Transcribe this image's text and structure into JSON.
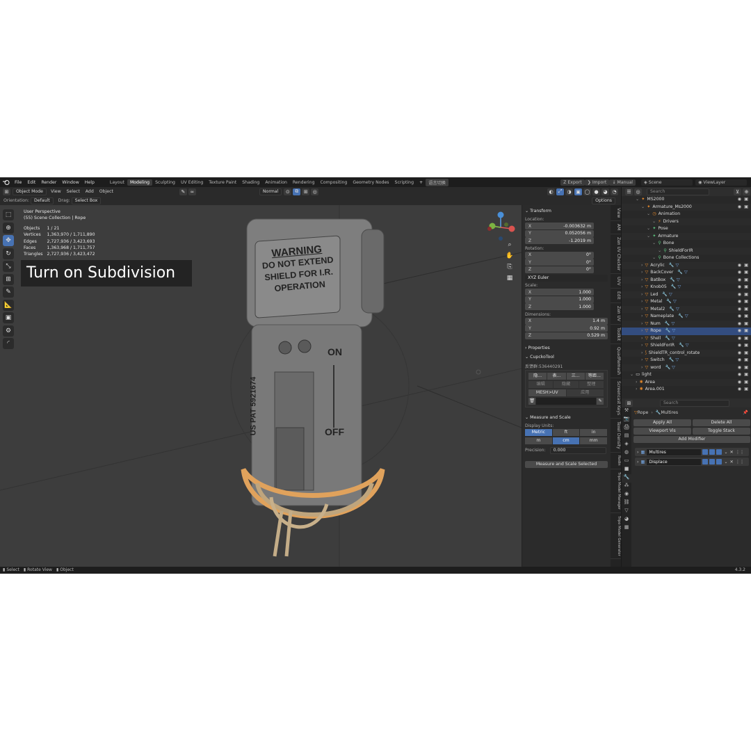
{
  "menubar": {
    "menus": [
      "File",
      "Edit",
      "Render",
      "Window",
      "Help"
    ],
    "workspaces": [
      "Layout",
      "Modeling",
      "Sculpting",
      "UV Editing",
      "Texture Paint",
      "Shading",
      "Animation",
      "Rendering",
      "Compositing",
      "Geometry Nodes",
      "Scripting"
    ],
    "active_workspace": "Modeling",
    "lang_button": "语言切换",
    "export": "Export",
    "import": "Import",
    "manual": "Manual",
    "scene": "Scene",
    "view_layer": "ViewLayer"
  },
  "header": {
    "mode": "Object Mode",
    "menus": [
      "View",
      "Select",
      "Add",
      "Object"
    ],
    "shading_pivot": "Normal",
    "orientation_label": "Orientation:",
    "orientation": "Default",
    "drag_label": "Drag:",
    "drag": "Select Box",
    "options": "Options"
  },
  "viewport": {
    "perspective": "User Perspective",
    "collection": "(55) Scene Collection | Rope",
    "stats": [
      {
        "label": "Objects",
        "value": "1 / 21"
      },
      {
        "label": "Vertices",
        "value": "1,363,970 / 1,711,890"
      },
      {
        "label": "Edges",
        "value": "2,727,936 / 3,423,693"
      },
      {
        "label": "Faces",
        "value": "1,363,968 / 1,711,757"
      },
      {
        "label": "Triangles",
        "value": "2,727,936 / 3,423,472"
      }
    ],
    "caption": "Turn on Subdivision",
    "model_text": {
      "warning": "WARNING",
      "line1": "DO NOT EXTEND",
      "line2": "SHIELD FOR I.R.",
      "line3": "OPERATION",
      "on": "ON",
      "off": "OFF",
      "side": "US PAT 5921674"
    }
  },
  "npanel": {
    "transform_title": "Transform",
    "location_label": "Location:",
    "location": [
      {
        "axis": "X",
        "value": "-0.003632 m"
      },
      {
        "axis": "Y",
        "value": "0.052056 m"
      },
      {
        "axis": "Z",
        "value": "-1.2019 m"
      }
    ],
    "rotation_label": "Rotation:",
    "rotation": [
      {
        "axis": "X",
        "value": "0°"
      },
      {
        "axis": "Y",
        "value": "0°"
      },
      {
        "axis": "Z",
        "value": "0°"
      }
    ],
    "rotation_mode": "XYZ Euler",
    "scale_label": "Scale:",
    "scale": [
      {
        "axis": "X",
        "value": "1.000"
      },
      {
        "axis": "Y",
        "value": "1.000"
      },
      {
        "axis": "Z",
        "value": "1.000"
      }
    ],
    "dimensions_label": "Dimensions:",
    "dimensions": [
      {
        "axis": "X",
        "value": "1.4 m"
      },
      {
        "axis": "Y",
        "value": "0.92 m"
      },
      {
        "axis": "Z",
        "value": "0.529 m"
      }
    ],
    "properties_title": "Properties",
    "cupcko_title": "CupckoTool",
    "feedback": "反馈群:536440291",
    "cupcko_buttons": [
      "隐...",
      "表...",
      "三...",
      "等距..."
    ],
    "cupcko_row2": [
      "编辑",
      "隐藏",
      "整理"
    ],
    "mesh_uv": "MESH>UV",
    "apply": "应用",
    "measure_title": "Measure and Scale",
    "display_units_label": "Display Units:",
    "units1": [
      "Metric",
      "ft",
      "in"
    ],
    "units2": [
      "m",
      "cm",
      "mm"
    ],
    "precision_label": "Precision:",
    "precision": "0.000",
    "measure_button": "Measure and Scale Selected"
  },
  "tabstrip": [
    "View",
    "AM",
    "Zen UV Checker",
    "UVV",
    "Edit",
    "Zen UV",
    "Toolkit",
    "QuadRemesh",
    "Screencast Keys",
    "Texel Density",
    "Rodin",
    "Tripo Model Manager",
    "Tripo Model Generator"
  ],
  "outliner": {
    "search_placeholder": "Search",
    "rows": [
      {
        "indent": 2,
        "label": "MS2000",
        "icon": "armature",
        "sel": false
      },
      {
        "indent": 3,
        "label": "Armature_Ms2000",
        "icon": "armature",
        "sel": false
      },
      {
        "indent": 4,
        "label": "Animation",
        "icon": "anim",
        "sel": false
      },
      {
        "indent": 5,
        "label": "Drivers",
        "icon": "driver",
        "sel": false
      },
      {
        "indent": 4,
        "label": "Pose",
        "icon": "pose",
        "sel": false
      },
      {
        "indent": 4,
        "label": "Armature",
        "icon": "arm",
        "sel": false
      },
      {
        "indent": 5,
        "label": "Bone",
        "icon": "bone",
        "sel": false
      },
      {
        "indent": 6,
        "label": "ShieldForIR",
        "icon": "bone",
        "sel": false
      },
      {
        "indent": 5,
        "label": "Bone Collections",
        "icon": "bone",
        "sel": false
      },
      {
        "indent": 3,
        "label": "Acrylic",
        "icon": "mesh",
        "sel": false
      },
      {
        "indent": 3,
        "label": "BackCover",
        "icon": "mesh",
        "sel": false
      },
      {
        "indent": 3,
        "label": "BatBox",
        "icon": "mesh",
        "sel": false
      },
      {
        "indent": 3,
        "label": "Knob05",
        "icon": "mesh",
        "sel": false
      },
      {
        "indent": 3,
        "label": "Led",
        "icon": "mesh",
        "sel": false
      },
      {
        "indent": 3,
        "label": "Metal",
        "icon": "mesh",
        "sel": false
      },
      {
        "indent": 3,
        "label": "Metal2",
        "icon": "mesh",
        "sel": false
      },
      {
        "indent": 3,
        "label": "Nameplate",
        "icon": "mesh",
        "sel": false
      },
      {
        "indent": 3,
        "label": "Num",
        "icon": "mesh",
        "sel": false
      },
      {
        "indent": 3,
        "label": "Rope",
        "icon": "mesh",
        "sel": true
      },
      {
        "indent": 3,
        "label": "Shell",
        "icon": "mesh",
        "sel": false
      },
      {
        "indent": 3,
        "label": "ShieldForIR",
        "icon": "mesh",
        "sel": false
      },
      {
        "indent": 3,
        "label": "ShieldTR_control_rotate",
        "icon": "curve",
        "sel": false
      },
      {
        "indent": 3,
        "label": "Switch",
        "icon": "mesh",
        "sel": false
      },
      {
        "indent": 3,
        "label": "word",
        "icon": "mesh",
        "sel": false
      },
      {
        "indent": 1,
        "label": "light",
        "icon": "coll",
        "sel": false
      },
      {
        "indent": 2,
        "label": "Area",
        "icon": "light",
        "sel": false
      },
      {
        "indent": 2,
        "label": "Area.001",
        "icon": "light",
        "sel": false
      }
    ]
  },
  "properties": {
    "search_placeholder": "Search",
    "object": "Rope",
    "modifier_crumb": "Multires",
    "apply_all": "Apply All",
    "delete_all": "Delete All",
    "viewport_vis": "Viewport Vis",
    "toggle_stack": "Toggle Stack",
    "add_modifier": "Add Modifier",
    "modifiers": [
      "Multires",
      "Displace"
    ]
  },
  "status": {
    "select": "Select",
    "rotate": "Rotate View",
    "object": "Object",
    "version": "4.3.2"
  },
  "colors": {
    "accent": "#4772b3",
    "selection": "#e88a2a",
    "bg": "#3d3d3d"
  }
}
